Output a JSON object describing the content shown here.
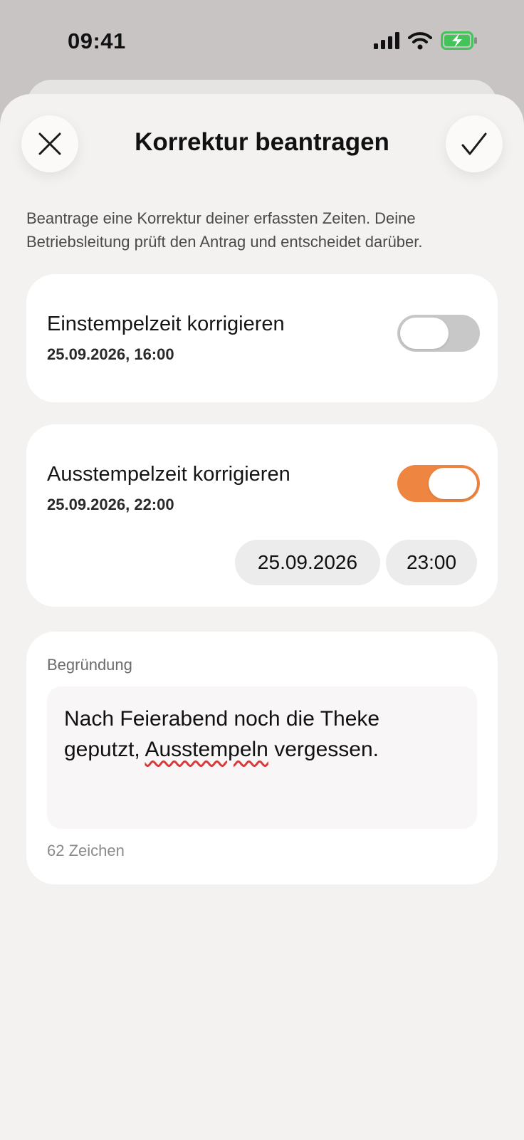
{
  "status": {
    "time": "09:41"
  },
  "header": {
    "title": "Korrektur beantragen"
  },
  "intro": "Beantrage eine Korrektur deiner erfassten Zeiten. Deine Betriebsleitung prüft den Antrag und entscheidet darüber.",
  "clock_in": {
    "title": "Einstempelzeit korrigieren",
    "timestamp": "25.09.2026, 16:00",
    "enabled": false
  },
  "clock_out": {
    "title": "Ausstempelzeit korrigieren",
    "timestamp": "25.09.2026, 22:00",
    "enabled": true,
    "new_date": "25.09.2026",
    "new_time": "23:00"
  },
  "reason": {
    "label": "Begründung",
    "text_part1": "Nach Feierabend noch die Theke geputzt, ",
    "text_misspelled": "Ausstempeln",
    "text_part2": " vergessen.",
    "char_count": "62 Zeichen"
  },
  "colors": {
    "accent": "#ee8540",
    "toggle_off": "#c9c8c8",
    "battery": "#43c35a"
  }
}
